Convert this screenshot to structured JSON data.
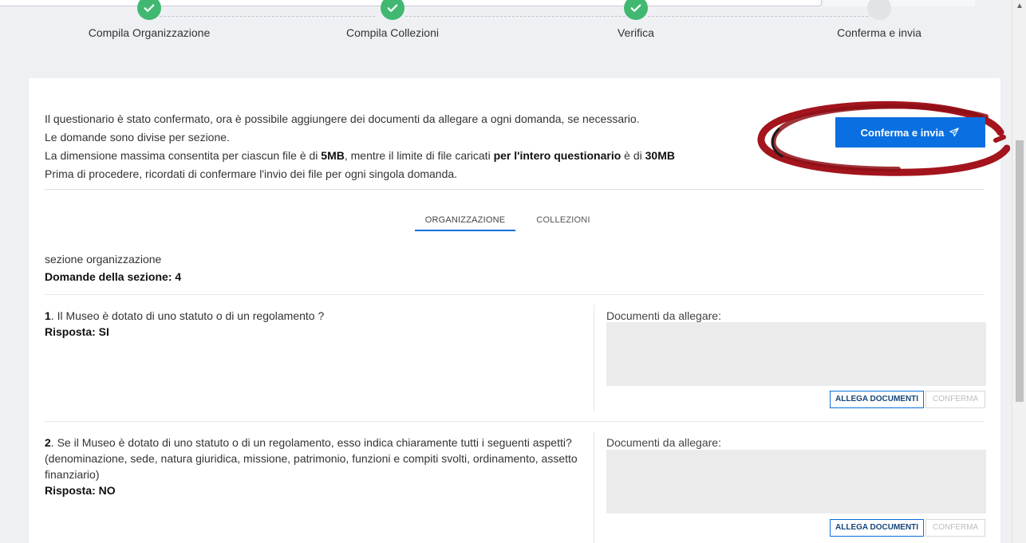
{
  "stepper": {
    "steps": [
      {
        "label": "Compila Organizzazione",
        "status": "done"
      },
      {
        "label": "Compila Collezioni",
        "status": "done"
      },
      {
        "label": "Verifica",
        "status": "done"
      },
      {
        "label": "Conferma e invia",
        "status": "todo"
      }
    ]
  },
  "intro": {
    "line1": "Il questionario è stato confermato, ora è possibile aggiungere dei documenti da allegare a ogni domanda, se necessario.",
    "line2": "Le domande sono divise per sezione.",
    "line3_a": "La dimensione massima consentita per ciascun file è di ",
    "line3_b": "5MB",
    "line3_c": ", mentre il limite di file caricati ",
    "line3_d": "per l'intero questionario",
    "line3_e": " è di ",
    "line3_f": "30MB",
    "line4": "Prima di procedere, ricordati di confermare l'invio dei file per ogni singola domanda."
  },
  "confirm_button": {
    "label": "Conferma e invia"
  },
  "tabs": [
    {
      "label": "ORGANIZZAZIONE",
      "active": true
    },
    {
      "label": "COLLEZIONI",
      "active": false
    }
  ],
  "section": {
    "name": "sezione organizzazione",
    "count_label": "Domande della sezione: 4"
  },
  "questions": [
    {
      "number": "1",
      "text": ". Il Museo è dotato di uno statuto o di un regolamento ?",
      "answer": "Risposta: SI",
      "docs_label": "Documenti da allegare:",
      "attach_label": "ALLEGA DOCUMENTI",
      "confirm_label": "CONFERMA"
    },
    {
      "number": "2",
      "text": ". Se il Museo è dotato di uno statuto o di un regolamento, esso indica chiaramente tutti i seguenti aspetti? (denominazione, sede, natura giuridica, missione, patrimonio, funzioni e compiti svolti, ordinamento, assetto finanziario)",
      "answer": "Risposta: NO",
      "docs_label": "Documenti da allegare:",
      "attach_label": "ALLEGA DOCUMENTI",
      "confirm_label": "CONFERMA"
    }
  ],
  "colors": {
    "primary": "#0a6fe0",
    "success": "#41b871",
    "annotation": "#a3141c"
  }
}
